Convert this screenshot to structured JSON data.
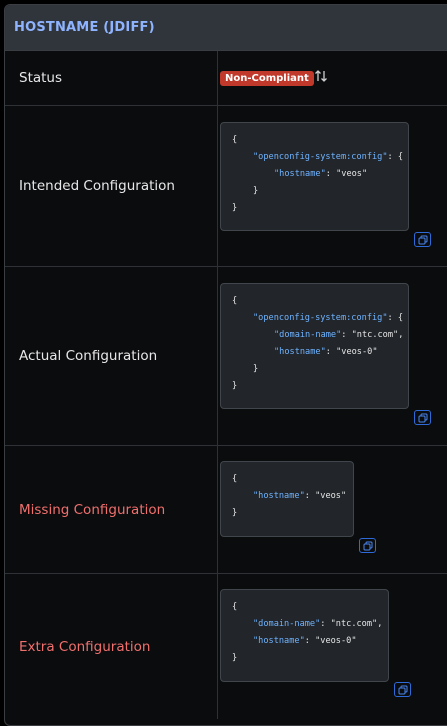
{
  "panel": {
    "title": "HOSTNAME (JDIFF)"
  },
  "rows": {
    "status": {
      "label": "Status",
      "badge": "Non-Compliant",
      "badge_color": "#c0392b"
    },
    "intended": {
      "label": "Intended Configuration",
      "code": {
        "open": "{",
        "section_key": "\"openconfig-system:config\"",
        "section_open": ": {",
        "hostname_key": "\"hostname\"",
        "hostname_sep": ": ",
        "hostname_val": "\"veos\"",
        "section_close": "}",
        "close": "}"
      }
    },
    "actual": {
      "label": "Actual Configuration",
      "code": {
        "open": "{",
        "section_key": "\"openconfig-system:config\"",
        "section_open": ": {",
        "domain_key": "\"domain-name\"",
        "domain_sep": ": ",
        "domain_val": "\"ntc.com\",",
        "hostname_key": "\"hostname\"",
        "hostname_sep": ": ",
        "hostname_val": "\"veos-0\"",
        "section_close": "}",
        "close": "}"
      }
    },
    "missing": {
      "label": "Missing Configuration",
      "code": {
        "open": "{",
        "hostname_key": "\"hostname\"",
        "hostname_sep": ": ",
        "hostname_val": "\"veos\"",
        "close": "}"
      }
    },
    "extra": {
      "label": "Extra Configuration",
      "code": {
        "open": "{",
        "domain_key": "\"domain-name\"",
        "domain_sep": ": ",
        "domain_val": "\"ntc.com\",",
        "hostname_key": "\"hostname\"",
        "hostname_sep": ": ",
        "hostname_val": "\"veos-0\"",
        "close": "}"
      }
    }
  },
  "icons": {
    "sort": "sort-arrows-icon",
    "copy": "copy-icon"
  },
  "colors": {
    "title": "#8fb4ff",
    "missing_label": "#f0706e",
    "json_key": "#6fb3ff",
    "copy_border": "#2f6bd8"
  }
}
